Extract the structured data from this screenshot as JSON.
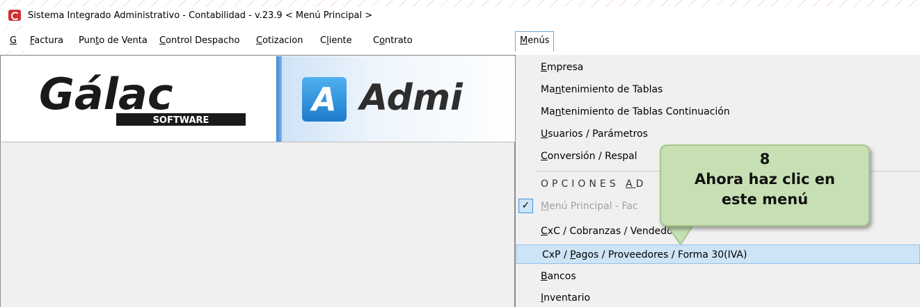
{
  "window": {
    "title": "Sistema Integrado Administrativo - Contabilidad - v.23.9 < Menú Principal >"
  },
  "menubar": {
    "items": [
      {
        "label": "G",
        "underline_index": 0
      },
      {
        "label": "Factura",
        "underline_index": 0
      },
      {
        "label": "Punto de Venta",
        "underline_index": 3
      },
      {
        "label": "Control Despacho",
        "underline_index": 0
      },
      {
        "label": "Cotizacion",
        "underline_index": 0
      },
      {
        "label": "Cliente",
        "underline_index": 1
      },
      {
        "label": "Contrato",
        "underline_index": 1
      },
      {
        "label": "Menús",
        "underline_index": 0,
        "active": true
      }
    ]
  },
  "banner": {
    "brand_logo": "Gálac",
    "brand_sub": "SOFTWARE",
    "product_letter": "A",
    "product_text": "Admi"
  },
  "dropdown": {
    "items": [
      {
        "label": "Empresa"
      },
      {
        "label": "Mantenimiento de Tablas"
      },
      {
        "label": "Mantenimiento de Tablas Continuación"
      },
      {
        "label": "Usuarios / Parámetros"
      },
      {
        "label": "Conversión / Respal"
      },
      {
        "label": "OPCIONES AD"
      },
      {
        "label": "Menú Principal - Fac",
        "checked": true
      },
      {
        "label": "CxC / Cobranzas / Vendedor"
      },
      {
        "label": "CxP / Pagos / Proveedores / Forma 30(IVA)",
        "highlighted": true
      },
      {
        "label": "Bancos"
      },
      {
        "label": "Inventario"
      }
    ]
  },
  "callout": {
    "line1": "8",
    "line2": "Ahora haz clic en",
    "line3": "este menú"
  },
  "colors": {
    "highlight": "#cde4f7",
    "callout_bg": "#c6e0b4",
    "brand_red": "#d32f2f",
    "brand_blue": "#1d7ccc"
  }
}
